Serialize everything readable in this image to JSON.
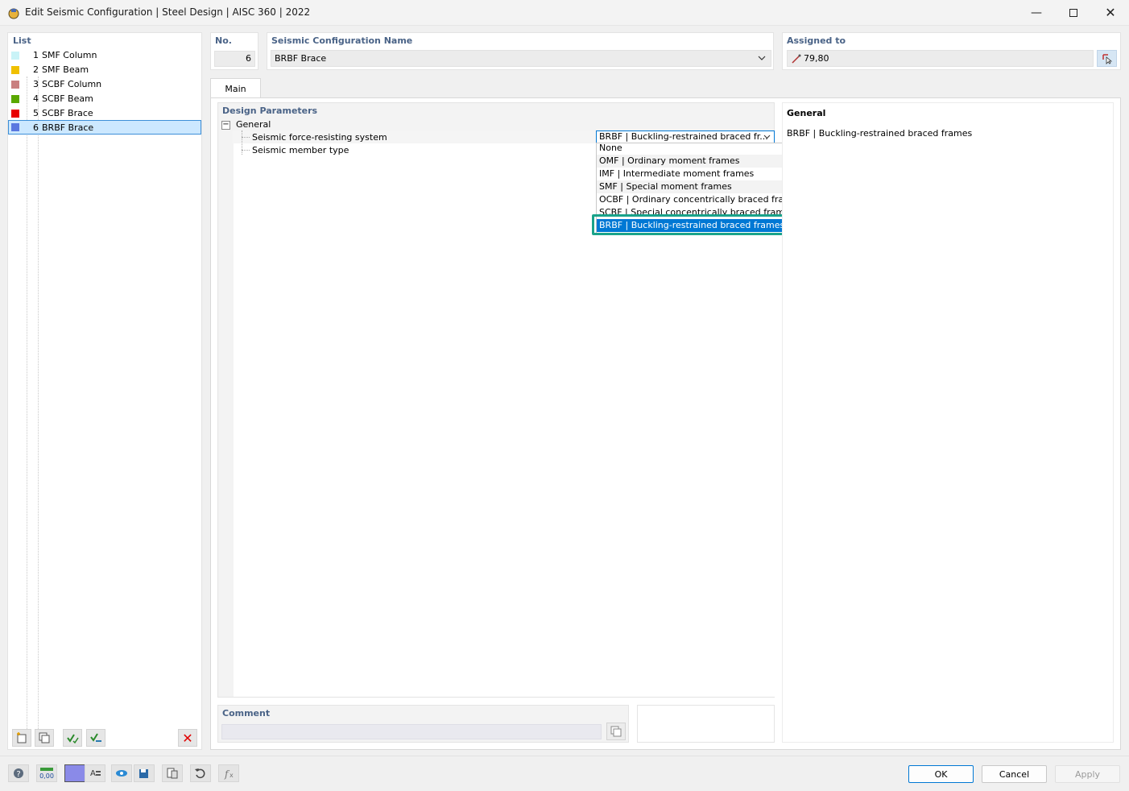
{
  "window": {
    "title": "Edit Seismic Configuration | Steel Design | AISC 360 | 2022",
    "minimize_icon": "minimize-icon",
    "maximize_icon": "maximize-icon",
    "close_icon": "close-icon"
  },
  "list": {
    "header": "List",
    "items": [
      {
        "num": "1",
        "label": "SMF Column",
        "color": "#c9f3f7"
      },
      {
        "num": "2",
        "label": "SMF Beam",
        "color": "#f0c000"
      },
      {
        "num": "3",
        "label": "SCBF Column",
        "color": "#c98080"
      },
      {
        "num": "4",
        "label": "SCBF Beam",
        "color": "#5aa800"
      },
      {
        "num": "5",
        "label": "SCBF Brace",
        "color": "#e80000"
      },
      {
        "num": "6",
        "label": "BRBF Brace",
        "color": "#5a78e0"
      }
    ],
    "selected_index": 5
  },
  "header": {
    "no_label": "No.",
    "no_value": "6",
    "name_label": "Seismic Configuration Name",
    "name_value": "BRBF Brace",
    "assigned_label": "Assigned to",
    "assigned_value": "79,80"
  },
  "tabs": [
    {
      "label": "Main"
    }
  ],
  "design": {
    "section_title": "Design Parameters",
    "group": "General",
    "rows": [
      {
        "label": "Seismic force-resisting system",
        "value": "BRBF | Buckling-restrained braced fr..."
      },
      {
        "label": "Seismic member type",
        "value": ""
      }
    ],
    "dropdown_options": [
      "None",
      "OMF | Ordinary moment frames",
      "IMF | Intermediate moment frames",
      "SMF | Special moment frames",
      "OCBF | Ordinary concentrically braced frames",
      "SCBF | Special concentrically braced frames",
      "BRBF | Buckling-restrained braced frames"
    ],
    "selected_option": 6
  },
  "info": {
    "title": "General",
    "text": "BRBF | Buckling-restrained braced frames"
  },
  "comment": {
    "label": "Comment",
    "value": ""
  },
  "buttons": {
    "ok": "OK",
    "cancel": "Cancel",
    "apply": "Apply"
  },
  "colors": {
    "accent": "#0078d4",
    "highlight_frame": "#1aa38a",
    "label_blue": "#4a6387"
  }
}
